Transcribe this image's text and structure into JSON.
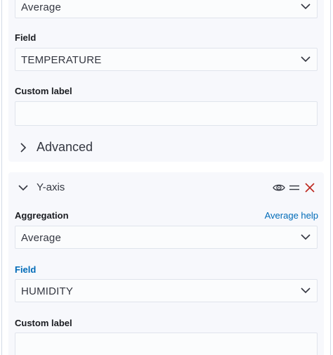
{
  "agg_panel_top": {
    "aggregation_value": "Average",
    "field_label": "Field",
    "field_value": "TEMPERATURE",
    "custom_label_label": "Custom label",
    "custom_label_value": "",
    "advanced_label": "Advanced"
  },
  "y_axis_panel": {
    "title": "Y-axis",
    "icons": [
      "eye-icon",
      "drag-handle-icon",
      "close-icon"
    ],
    "aggregation_label": "Aggregation",
    "aggregation_help_link": "Average help",
    "aggregation_value": "Average",
    "field_label": "Field",
    "field_value": "HUMIDITY",
    "custom_label_label": "Custom label",
    "custom_label_value": ""
  },
  "colors": {
    "panel_bg": "#f7f8fc",
    "link_blue": "#006bb8",
    "close_red": "#bd271e",
    "text": "#343741"
  }
}
